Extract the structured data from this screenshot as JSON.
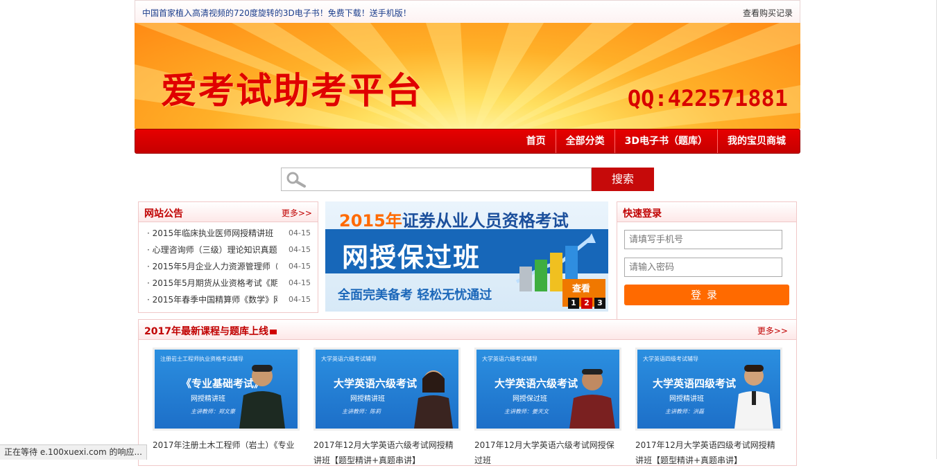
{
  "topbar": {
    "notice": "中国首家植入高清视频的720度旋转的3D电子书！免费下载！送手机版！",
    "record_link": "查看购买记录"
  },
  "banner": {
    "title": "爱考试助考平台",
    "qq": "QQ:422571881"
  },
  "nav": {
    "items": [
      "首页",
      "全部分类",
      "3D电子书（题库）",
      "我的宝贝商城"
    ]
  },
  "search": {
    "placeholder": "",
    "button": "搜索"
  },
  "announcements": {
    "title": "网站公告",
    "more": "更多>>",
    "items": [
      {
        "text": "· 2015年临床执业医师网授精讲班【",
        "date": "04-15"
      },
      {
        "text": "· 心理咨询师（三级）理论知识真题",
        "date": "04-15"
      },
      {
        "text": "· 2015年5月企业人力资源管理师（",
        "date": "04-15"
      },
      {
        "text": "· 2015年5月期货从业资格考试《期",
        "date": "04-15"
      },
      {
        "text": "· 2015年春季中国精算师《数学》网",
        "date": "04-15"
      }
    ]
  },
  "ad": {
    "year_prefix": "2015年",
    "line1": "证券从业人员资格考试",
    "line2": "网授保过班",
    "line3": "全面完美备考  轻松无忧通过",
    "see": "查看",
    "dots": [
      "1",
      "2",
      "3"
    ],
    "active_dot": 1
  },
  "login": {
    "title": "快速登录",
    "phone_placeholder": "请填写手机号",
    "password_placeholder": "请输入密码",
    "button": "登录"
  },
  "courses": {
    "title": "2017年最新课程与题库上线",
    "more": "更多>>",
    "items": [
      {
        "thumb_small": "注册岩土工程师执业资格考试辅导",
        "thumb_big": "《专业基础考试》",
        "thumb_sub": "网授精讲班",
        "thumb_teacher": "主讲教师：郑文豪",
        "caption": "2017年注册土木工程师（岩土）《专业"
      },
      {
        "thumb_small": "大学英语六级考试辅导",
        "thumb_big": "大学英语六级考试",
        "thumb_sub": "网授精讲班",
        "thumb_teacher": "主讲教师：陈莉",
        "caption": "2017年12月大学英语六级考试网授精讲班【题型精讲+真题串讲】"
      },
      {
        "thumb_small": "大学英语六级考试辅导",
        "thumb_big": "大学英语六级考试",
        "thumb_sub": "网授保过班",
        "thumb_teacher": "主讲教师：姜天文",
        "caption": "2017年12月大学英语六级考试网授保过班"
      },
      {
        "thumb_small": "大学英语四级考试辅导",
        "thumb_big": "大学英语四级考试",
        "thumb_sub": "网授精讲班",
        "thumb_teacher": "主讲教师：洪磊",
        "caption": "2017年12月大学英语四级考试网授精讲班【题型精讲+真题串讲】"
      }
    ]
  },
  "status_bar": "正在等待 e.100xuexi.com 的响应..."
}
